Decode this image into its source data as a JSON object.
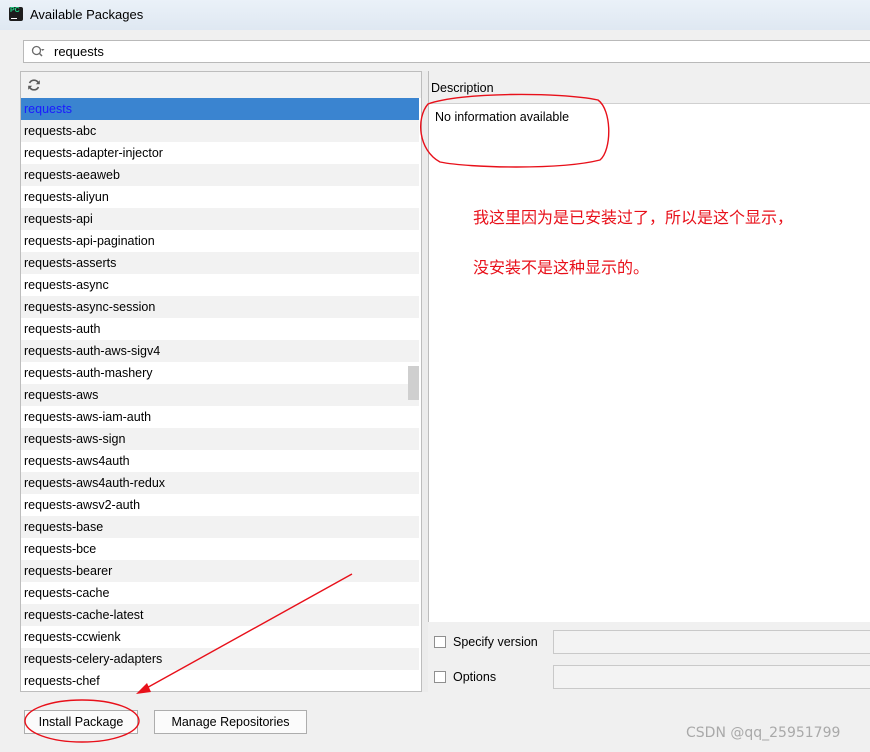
{
  "window": {
    "title": "Available Packages"
  },
  "search": {
    "value": "requests"
  },
  "packages": [
    "requests",
    "requests-abc",
    "requests-adapter-injector",
    "requests-aeaweb",
    "requests-aliyun",
    "requests-api",
    "requests-api-pagination",
    "requests-asserts",
    "requests-async",
    "requests-async-session",
    "requests-auth",
    "requests-auth-aws-sigv4",
    "requests-auth-mashery",
    "requests-aws",
    "requests-aws-iam-auth",
    "requests-aws-sign",
    "requests-aws4auth",
    "requests-aws4auth-redux",
    "requests-awsv2-auth",
    "requests-base",
    "requests-bce",
    "requests-bearer",
    "requests-cache",
    "requests-cache-latest",
    "requests-ccwienk",
    "requests-celery-adapters",
    "requests-chef"
  ],
  "selected_package": "requests",
  "description": {
    "header": "Description",
    "text": "No information available"
  },
  "annotation": {
    "line1": "我这里因为是已安装过了，所以是这个显示，",
    "line2": "没安装不是这种显示的。"
  },
  "options": {
    "specify_version_label": "Specify version",
    "options_label": "Options"
  },
  "buttons": {
    "install": "Install Package",
    "manage": "Manage Repositories"
  },
  "watermark": "CSDN @qq_25951799",
  "colors": {
    "selection": "#3a84d0",
    "selected_text": "#1a1aff",
    "annotation_red": "#e8101a"
  },
  "icons": [
    "app-icon",
    "search-icon",
    "refresh-icon"
  ]
}
